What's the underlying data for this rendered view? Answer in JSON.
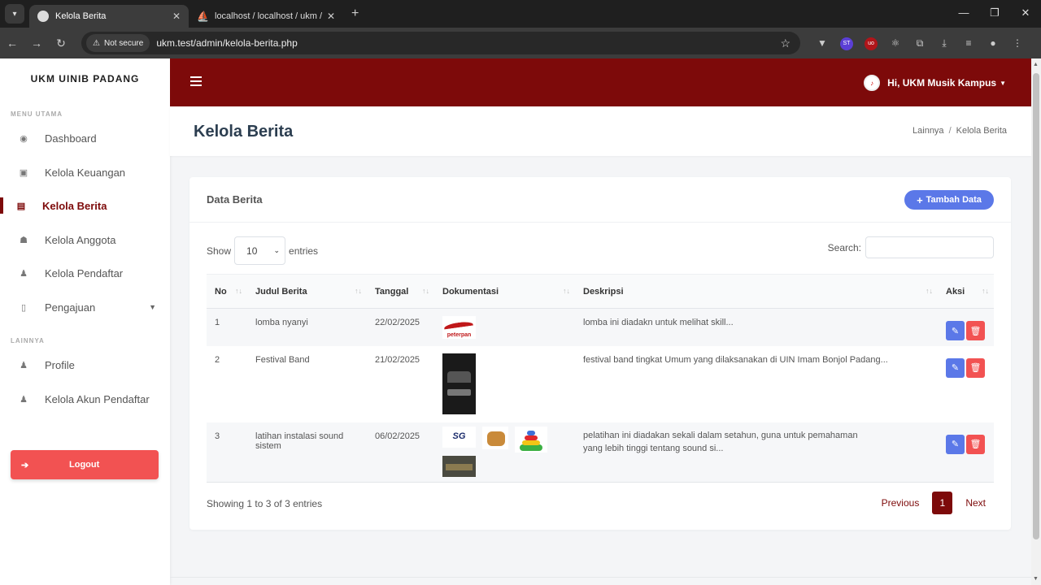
{
  "browser": {
    "tabs": [
      {
        "title": "Kelola Berita",
        "active": true
      },
      {
        "title": "localhost / localhost / ukm / us",
        "active": false
      }
    ],
    "security_label": "Not secure",
    "url": "ukm.test/admin/kelola-berita.php",
    "extensions": [
      "ST",
      "uo"
    ]
  },
  "sidebar": {
    "brand": "UKM UINIB PADANG",
    "section_main": "MENU UTAMA",
    "items_main": [
      {
        "label": "Dashboard",
        "icon": "palette-icon"
      },
      {
        "label": "Kelola Keuangan",
        "icon": "money-icon"
      },
      {
        "label": "Kelola Berita",
        "icon": "newspaper-icon",
        "active": true
      },
      {
        "label": "Kelola Anggota",
        "icon": "users-icon"
      },
      {
        "label": "Kelola Pendaftar",
        "icon": "user-plus-icon"
      },
      {
        "label": "Pengajuan",
        "icon": "file-icon",
        "dropdown": true
      }
    ],
    "section_other": "LAINNYA",
    "items_other": [
      {
        "label": "Profile",
        "icon": "user-icon"
      },
      {
        "label": "Kelola Akun Pendaftar",
        "icon": "user-cog-icon"
      }
    ],
    "logout_label": "Logout"
  },
  "topbar": {
    "greeting": "Hi, UKM Musik Kampus"
  },
  "header": {
    "title": "Kelola Berita",
    "breadcrumb": [
      "Lainnya",
      "Kelola Berita"
    ]
  },
  "card": {
    "title": "Data Berita",
    "add_button": "Tambah Data",
    "show_label": "Show",
    "entries_value": "10",
    "entries_label": "entries",
    "search_label": "Search:",
    "search_value": "",
    "columns": [
      "No",
      "Judul Berita",
      "Tanggal",
      "Dokumentasi",
      "Deskripsi",
      "Aksi"
    ],
    "rows": [
      {
        "no": "1",
        "judul": "lomba nyanyi",
        "tanggal": "22/02/2025",
        "deskripsi": "lomba ini diadakn untuk melihat skill...",
        "doc_label": "peterpan"
      },
      {
        "no": "2",
        "judul": "Festival Band",
        "tanggal": "21/02/2025",
        "deskripsi": "festival band tingkat Umum yang dilaksanakan di UIN Imam Bonjol Padang..."
      },
      {
        "no": "3",
        "judul": "latihan instalasi sound sistem",
        "tanggal": "06/02/2025",
        "deskripsi": "pelatihan ini diadakan sekali dalam setahun, guna untuk pemahaman yang lebih tinggi tentang sound si...",
        "doc_label": "SG"
      }
    ],
    "info": "Showing 1 to 3 of 3 entries",
    "pagination": {
      "previous": "Previous",
      "current": "1",
      "next": "Next"
    }
  },
  "colors": {
    "primary": "#7d0a0a",
    "accent": "#5b78e8",
    "danger": "#f25252"
  }
}
